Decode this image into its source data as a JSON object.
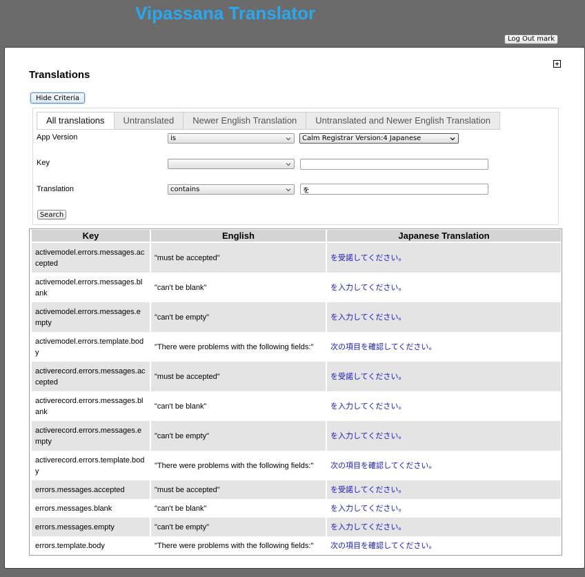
{
  "header": {
    "app_title": "Vipassana Translator",
    "logout_label": "Log Out mark"
  },
  "page": {
    "section_title": "Translations",
    "hide_criteria_label": "Hide Criteria"
  },
  "criteria": {
    "tabs": [
      {
        "label": "All translations",
        "active": true
      },
      {
        "label": "Untranslated",
        "active": false
      },
      {
        "label": "Newer English Translation",
        "active": false
      },
      {
        "label": "Untranslated and Newer English Translation",
        "active": false
      }
    ],
    "app_version": {
      "label": "App Version",
      "operator": "is",
      "value": "Calm Registrar Version:4 Japanese"
    },
    "key": {
      "label": "Key",
      "operator": "",
      "value": ""
    },
    "translation": {
      "label": "Translation",
      "operator": "contains",
      "value": "を"
    },
    "search_label": "Search"
  },
  "table": {
    "headers": [
      "Key",
      "English",
      "Japanese Translation"
    ],
    "rows": [
      [
        "activemodel.errors.messages.accepted",
        "\"must be accepted\"",
        "を受諾してください。"
      ],
      [
        "activemodel.errors.messages.blank",
        "\"can't be blank\"",
        "を入力してください。"
      ],
      [
        "activemodel.errors.messages.empty",
        "\"can't be empty\"",
        "を入力してください。"
      ],
      [
        "activemodel.errors.template.body",
        "\"There were problems with the following fields:\"",
        "次の項目を確認してください。"
      ],
      [
        "activerecord.errors.messages.accepted",
        "\"must be accepted\"",
        "を受諾してください。"
      ],
      [
        "activerecord.errors.messages.blank",
        "\"can't be blank\"",
        "を入力してください。"
      ],
      [
        "activerecord.errors.messages.empty",
        "\"can't be empty\"",
        "を入力してください。"
      ],
      [
        "activerecord.errors.template.body",
        "\"There were problems with the following fields:\"",
        "次の項目を確認してください。"
      ],
      [
        "errors.messages.accepted",
        "\"must be accepted\"",
        "を受諾してください。"
      ],
      [
        "errors.messages.blank",
        "\"can't be blank\"",
        "を入力してください。"
      ],
      [
        "errors.messages.empty",
        "\"can't be empty\"",
        "を入力してください。"
      ],
      [
        "errors.template.body",
        "\"There were problems with the following fields:\"",
        "次の項目を確認してください。"
      ]
    ]
  }
}
